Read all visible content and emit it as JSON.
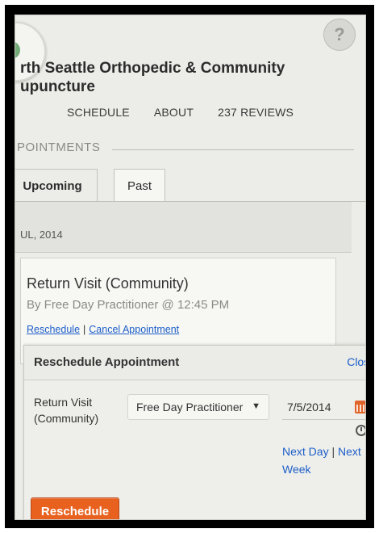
{
  "header": {
    "clinic_name": "rth Seattle Orthopedic & Community upuncture",
    "avatar_icon": "user-placeholder-icon"
  },
  "nav": {
    "schedule": "SCHEDULE",
    "about": "ABOUT",
    "reviews": "237 REVIEWS"
  },
  "appointments": {
    "section_title": "POINTMENTS",
    "tabs": {
      "upcoming": "Upcoming",
      "past": "Past"
    },
    "month": "UL, 2014",
    "item": {
      "title": "Return Visit (Community)",
      "subtitle": "By Free Day Practitioner @ 12:45 PM",
      "reschedule_link": "Reschedule",
      "cancel_link": "Cancel Appointment"
    }
  },
  "reschedule_panel": {
    "title": "Reschedule Appointment",
    "close": "Close",
    "visit_label": "Return Visit (Community)",
    "practitioner_selected": "Free Day Practitioner",
    "date_value": "7/5/2014",
    "next_day": "Next Day",
    "next_week": "Next Week",
    "submit": "Reschedule"
  },
  "colors": {
    "accent": "#e8611f",
    "link": "#1d5fc9"
  }
}
